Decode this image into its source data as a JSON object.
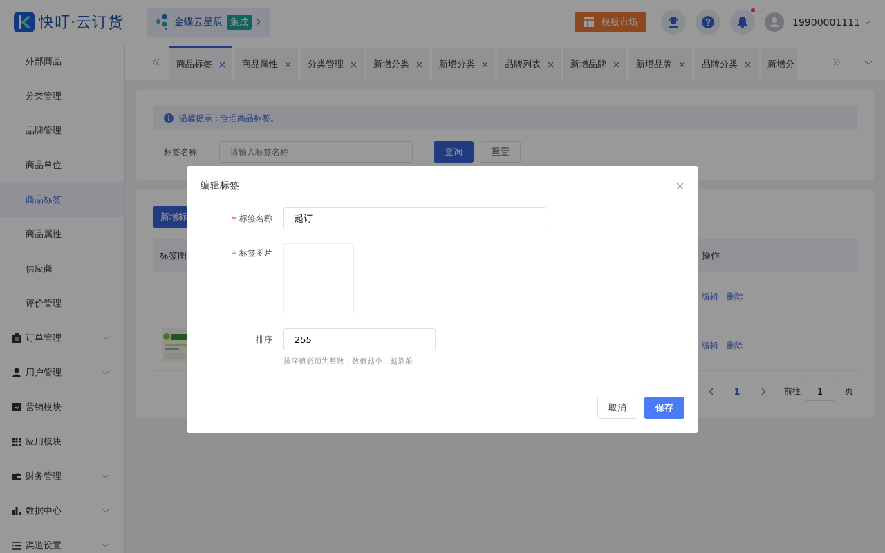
{
  "header": {
    "logo_text": "快叮·云订货",
    "integration": {
      "name": "金蝶云星辰",
      "badge": "集成"
    },
    "template_button": "模板市场",
    "user": "19900001111",
    "notification_dot": true
  },
  "sidebar": {
    "items": [
      {
        "label": "外部商品",
        "kind": "sub",
        "selected": false
      },
      {
        "label": "分类管理",
        "kind": "sub",
        "selected": false
      },
      {
        "label": "品牌管理",
        "kind": "sub",
        "selected": false
      },
      {
        "label": "商品单位",
        "kind": "sub",
        "selected": false
      },
      {
        "label": "商品标签",
        "kind": "sub",
        "selected": true
      },
      {
        "label": "商品属性",
        "kind": "sub",
        "selected": false
      },
      {
        "label": "供应商",
        "kind": "sub",
        "selected": false
      },
      {
        "label": "评价管理",
        "kind": "sub",
        "selected": false
      },
      {
        "label": "订单管理",
        "kind": "group",
        "expandable": true
      },
      {
        "label": "用户管理",
        "kind": "group",
        "expandable": true
      },
      {
        "label": "营销模块",
        "kind": "group",
        "expandable": false
      },
      {
        "label": "应用模块",
        "kind": "group",
        "expandable": false
      },
      {
        "label": "财务管理",
        "kind": "group",
        "expandable": true
      },
      {
        "label": "数据中心",
        "kind": "group",
        "expandable": true
      },
      {
        "label": "渠道设置",
        "kind": "group",
        "expandable": true
      }
    ]
  },
  "tabs": [
    {
      "label": "商品标签",
      "selected": true
    },
    {
      "label": "商品属性",
      "selected": false
    },
    {
      "label": "分类管理",
      "selected": false
    },
    {
      "label": "新增分类",
      "selected": false
    },
    {
      "label": "新增分类",
      "selected": false
    },
    {
      "label": "品牌列表",
      "selected": false
    },
    {
      "label": "新增品牌",
      "selected": false
    },
    {
      "label": "新增品牌",
      "selected": false
    },
    {
      "label": "品牌分类",
      "selected": false
    },
    {
      "label": "新增分",
      "selected": false,
      "cut": true
    }
  ],
  "notice": "温馨提示：管理商品标签。",
  "filter": {
    "label": "标签名称",
    "placeholder": "请输入标签名称",
    "search_button": "查询",
    "reset_button": "重置"
  },
  "list": {
    "add_button": "新增标",
    "columns": [
      "标签图",
      "操作"
    ],
    "rows": [
      {
        "image": false,
        "actions": [
          "编辑",
          "删除"
        ]
      },
      {
        "image": true,
        "actions": [
          "编辑",
          "删除"
        ]
      }
    ],
    "pagination": {
      "page": "1",
      "goto_label": "前往",
      "goto_value": "1",
      "page_suffix": "页"
    }
  },
  "dialog": {
    "title": "编辑标签",
    "fields": [
      {
        "kind": "text",
        "label": "标签名称",
        "required": true,
        "value": "起订"
      },
      {
        "label": "标签图片",
        "required": true
      },
      {
        "kind": "text",
        "label": "排序",
        "required": false,
        "value": "255",
        "hint": "排序值必须为整数；数值越小，越靠前"
      }
    ],
    "cancel": "取消",
    "save": "保存"
  }
}
